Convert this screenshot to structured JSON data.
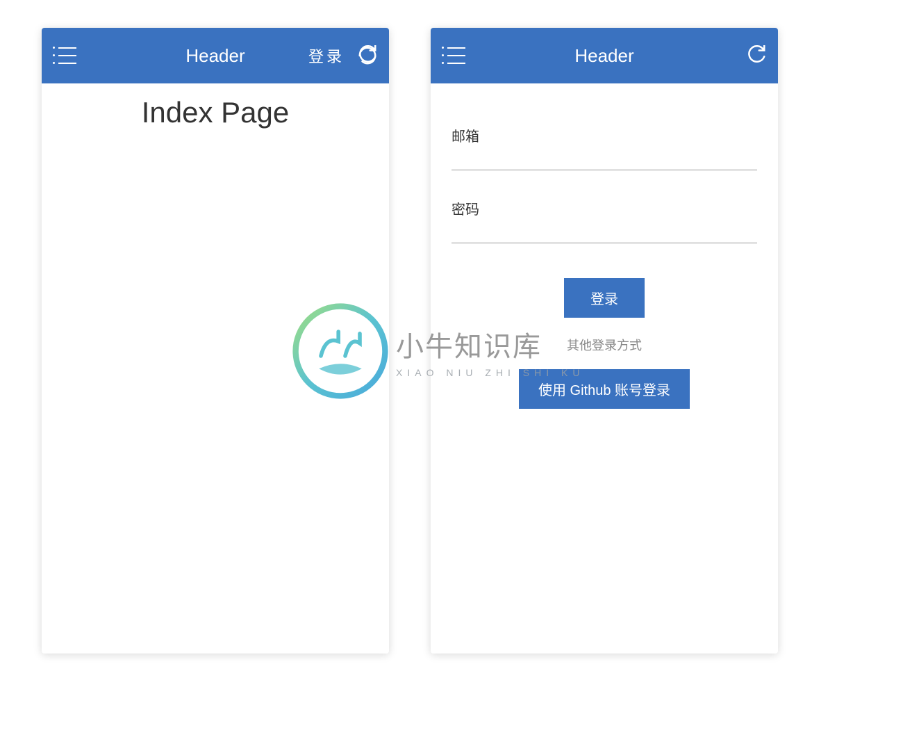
{
  "colors": {
    "primary": "#3a72c0",
    "text_dark": "#333333",
    "text_muted": "#888888"
  },
  "left_screen": {
    "header": {
      "title": "Header",
      "login_label": "登录"
    },
    "content": {
      "page_title": "Index Page"
    }
  },
  "right_screen": {
    "header": {
      "title": "Header"
    },
    "form": {
      "email_label": "邮箱",
      "password_label": "密码",
      "login_button": "登录",
      "other_login_text": "其他登录方式",
      "github_login_button": "使用 Github 账号登录"
    }
  },
  "watermark": {
    "text_cn": "小牛知识库",
    "text_en": "XIAO NIU ZHI SHI KU"
  }
}
